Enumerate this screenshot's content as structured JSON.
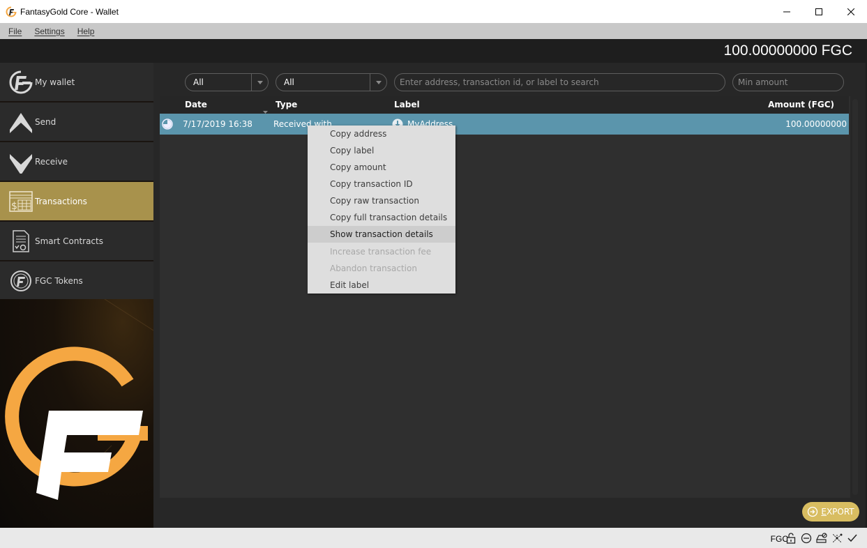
{
  "window": {
    "title": "FantasyGold Core - Wallet",
    "controls": [
      "minimize",
      "maximize",
      "close"
    ]
  },
  "menubar": {
    "items": [
      {
        "label": "File",
        "mnemonic": "F"
      },
      {
        "label": "Settings",
        "mnemonic": "S"
      },
      {
        "label": "Help",
        "mnemonic": "H"
      }
    ]
  },
  "header": {
    "balance": "100.00000000 FGC"
  },
  "sidebar": {
    "items": [
      {
        "label": "My wallet",
        "icon": "fg-logo-icon",
        "active": false
      },
      {
        "label": "Send",
        "icon": "send-arrow-up-icon",
        "active": false
      },
      {
        "label": "Receive",
        "icon": "receive-arrow-down-icon",
        "active": false
      },
      {
        "label": "Transactions",
        "icon": "transactions-icon",
        "active": true
      },
      {
        "label": "Smart Contracts",
        "icon": "smart-contract-icon",
        "active": false
      },
      {
        "label": "FGC Tokens",
        "icon": "token-icon",
        "active": false
      }
    ]
  },
  "filters": {
    "date_filter": "All",
    "type_filter": "All",
    "search_placeholder": "Enter address, transaction id, or label to search",
    "min_amount_placeholder": "Min amount"
  },
  "table": {
    "columns": [
      "Date",
      "Type",
      "Label",
      "Amount (FGC)"
    ],
    "sort_column": "Date",
    "rows": [
      {
        "status_icon": "confirming-clock-icon",
        "date": "7/17/2019 16:38",
        "type": "Received with",
        "label_icon": "receive-icon",
        "label": "MyAddress",
        "amount": "100.00000000",
        "selected": true
      }
    ]
  },
  "context_menu": {
    "items": [
      {
        "label": "Copy address",
        "state": "normal"
      },
      {
        "label": "Copy label",
        "state": "normal"
      },
      {
        "label": "Copy amount",
        "state": "normal"
      },
      {
        "label": "Copy transaction ID",
        "state": "normal"
      },
      {
        "label": "Copy raw transaction",
        "state": "normal"
      },
      {
        "label": "Copy full transaction details",
        "state": "normal"
      },
      {
        "label": "Show transaction details",
        "state": "hover"
      },
      {
        "label": "Increase transaction fee",
        "state": "disabled"
      },
      {
        "label": "Abandon transaction",
        "state": "disabled"
      },
      {
        "label": "Edit label",
        "state": "normal"
      }
    ]
  },
  "export_button": {
    "label_first": "E",
    "label_rest": "XPORT"
  },
  "statusbar": {
    "unit": "FGC",
    "icons": [
      "lock-icon",
      "staking-off-icon",
      "hd-disabled-icon",
      "network-icon",
      "synced-check-icon"
    ]
  },
  "colors": {
    "accent_gold": "#a8924c",
    "selection_blue": "#5b95ac",
    "export_gold": "#d8bd61",
    "logo_orange": "#f5a742"
  }
}
